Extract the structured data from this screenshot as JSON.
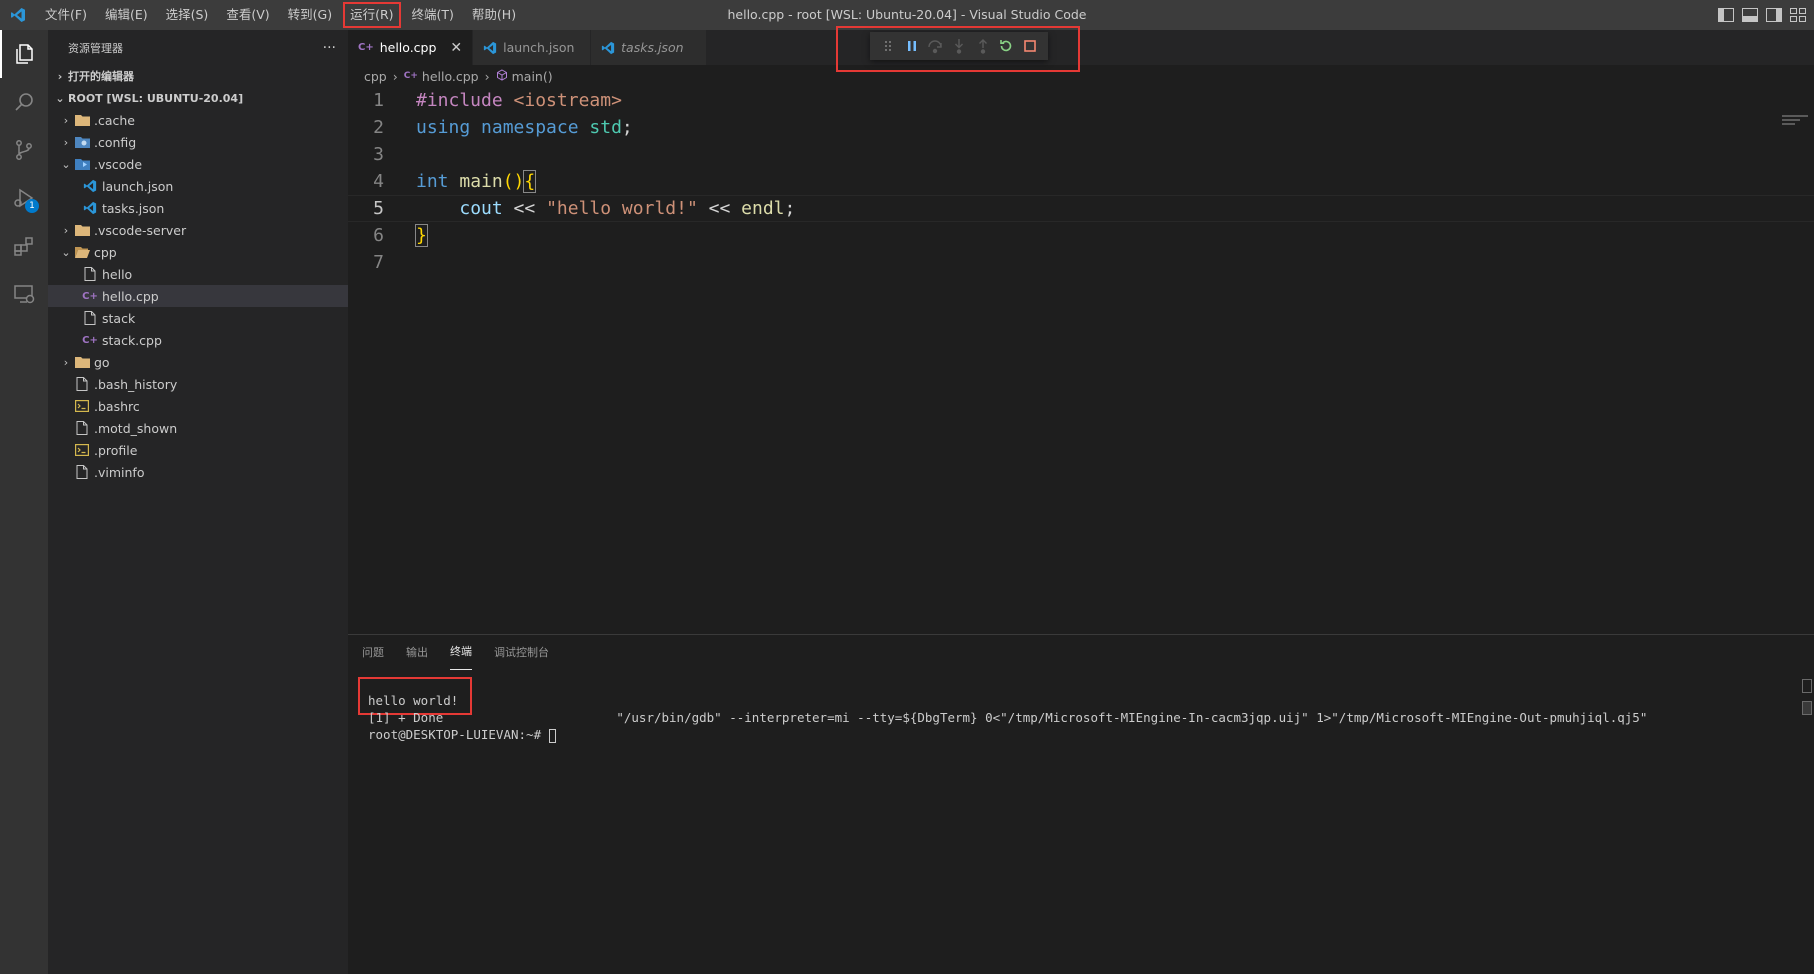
{
  "window": {
    "title": "hello.cpp - root [WSL: Ubuntu-20.04] - Visual Studio Code"
  },
  "menu": [
    {
      "label": "文件(F)"
    },
    {
      "label": "编辑(E)"
    },
    {
      "label": "选择(S)"
    },
    {
      "label": "查看(V)"
    },
    {
      "label": "转到(G)"
    },
    {
      "label": "运行(R)"
    },
    {
      "label": "终端(T)"
    },
    {
      "label": "帮助(H)"
    }
  ],
  "activity": {
    "debug_badge": "1"
  },
  "sidebar": {
    "title": "资源管理器",
    "more": "···",
    "open_editors": "打开的编辑器",
    "root": "ROOT [WSL: UBUNTU-20.04]",
    "tree": [
      {
        "label": ".cache"
      },
      {
        "label": ".config"
      },
      {
        "label": ".vscode"
      },
      {
        "label": "launch.json"
      },
      {
        "label": "tasks.json"
      },
      {
        "label": ".vscode-server"
      },
      {
        "label": "cpp"
      },
      {
        "label": "hello"
      },
      {
        "label": "hello.cpp"
      },
      {
        "label": "stack"
      },
      {
        "label": "stack.cpp"
      },
      {
        "label": "go"
      },
      {
        "label": ".bash_history"
      },
      {
        "label": ".bashrc"
      },
      {
        "label": ".motd_shown"
      },
      {
        "label": ".profile"
      },
      {
        "label": ".viminfo"
      }
    ]
  },
  "tabs": [
    {
      "label": "hello.cpp",
      "close": "✕"
    },
    {
      "label": "launch.json"
    },
    {
      "label": "tasks.json"
    }
  ],
  "breadcrumb": {
    "folder": "cpp",
    "file": "hello.cpp",
    "symbol": "main()"
  },
  "code": {
    "line_numbers": [
      "1",
      "2",
      "3",
      "4",
      "5",
      "6",
      "7"
    ],
    "l1a": "#include ",
    "l1b": "<iostream>",
    "l2a": "using ",
    "l2b": "namespace ",
    "l2c": "std",
    "l2d": ";",
    "l4a": "int ",
    "l4b": "main",
    "l4c": "()",
    "l4d": "{",
    "l5a": "    ",
    "l5b": "cout",
    "l5c": " << ",
    "l5d": "\"hello world!\"",
    "l5e": " << ",
    "l5f": "endl",
    "l5g": ";",
    "l6": "}"
  },
  "panel": {
    "tabs": [
      {
        "label": "问题"
      },
      {
        "label": "输出"
      },
      {
        "label": "终端"
      },
      {
        "label": "调试控制台"
      }
    ],
    "terminal": {
      "line1": "hello world!",
      "line2": "[1] + Done                       \"/usr/bin/gdb\" --interpreter=mi --tty=${DbgTerm} 0<\"/tmp/Microsoft-MIEngine-In-cacm3jqp.uij\" 1>\"/tmp/Microsoft-MIEngine-Out-pmuhjiql.qj5\"",
      "prompt": "root@DESKTOP-LUIEVAN:~# "
    }
  },
  "colors": {
    "accent": "#007acc",
    "highlight": "#e53935",
    "restart": "#89d185",
    "stop": "#f48771",
    "pause": "#75beff"
  }
}
